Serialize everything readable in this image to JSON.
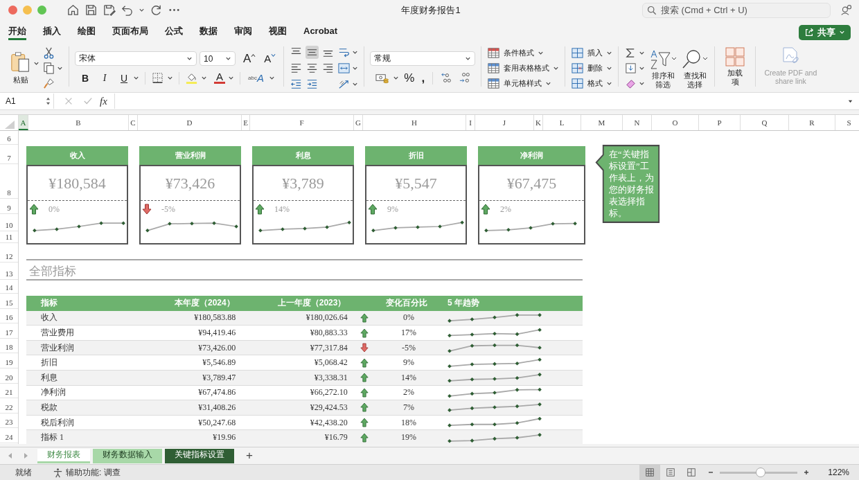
{
  "window": {
    "title": "年度财务报告1"
  },
  "search": {
    "placeholder": "搜索 (Cmd + Ctrl + U)"
  },
  "menu_tabs": [
    {
      "label": "开始",
      "selected": true
    },
    {
      "label": "插入",
      "selected": false
    },
    {
      "label": "绘图",
      "selected": false
    },
    {
      "label": "页面布局",
      "selected": false
    },
    {
      "label": "公式",
      "selected": false
    },
    {
      "label": "数据",
      "selected": false
    },
    {
      "label": "审阅",
      "selected": false
    },
    {
      "label": "视图",
      "selected": false
    },
    {
      "label": "Acrobat",
      "selected": false
    }
  ],
  "share_button": {
    "label": "共享"
  },
  "ribbon": {
    "paste": "粘贴",
    "font_name": "宋体",
    "font_size": "10",
    "grow_font": "A",
    "shrink_font": "A",
    "bold": "B",
    "italic": "I",
    "underline": "U",
    "font_color": "A",
    "abc_label": "abc",
    "abc_letter": "A",
    "number_format": "常规",
    "percent": "%",
    "comma": ",",
    "styles": [
      "条件格式",
      "套用表格格式",
      "单元格样式"
    ],
    "cells": [
      "插入",
      "删除",
      "格式"
    ],
    "sort": "排序和筛选",
    "find": "查找和选择",
    "addins": "加载项",
    "pdf": {
      "label": "Create PDF and share link",
      "disabled": true
    }
  },
  "formula_bar": {
    "name_box": "A1",
    "fx": "fx"
  },
  "columns": [
    "A",
    "B",
    "C",
    "D",
    "E",
    "F",
    "G",
    "H",
    "I",
    "J",
    "K",
    "L",
    "M",
    "N",
    "O",
    "P",
    "Q",
    "R",
    "S"
  ],
  "rows": [
    "6",
    "7",
    "8",
    "9",
    "10",
    "11",
    "12",
    "13",
    "14",
    "15",
    "16",
    "17",
    "18",
    "19",
    "20",
    "21",
    "22",
    "23",
    "24"
  ],
  "kpi_cards": [
    {
      "title": "收入",
      "value": "¥180,584",
      "rising": true,
      "change": "0%"
    },
    {
      "title": "营业利润",
      "value": "¥73,426",
      "rising": false,
      "change": "-5%"
    },
    {
      "title": "利息",
      "value": "¥3,789",
      "rising": true,
      "change": "14%"
    },
    {
      "title": "折旧",
      "value": "¥5,547",
      "rising": true,
      "change": "9%"
    },
    {
      "title": "净利润",
      "value": "¥67,475",
      "rising": true,
      "change": "2%"
    }
  ],
  "note": "在“关键指标设置”工作表上，为您的财务报表选择指标。",
  "section_title": "全部指标",
  "table": {
    "columns": [
      "指标",
      "本年度（2024）",
      "上一年度（2023）",
      "变化百分比",
      "5 年趋势"
    ],
    "rows": [
      {
        "name": "收入",
        "current": "¥180,583.88",
        "previous": "¥180,026.64",
        "rising": true,
        "change": "0%"
      },
      {
        "name": "营业费用",
        "current": "¥94,419.46",
        "previous": "¥80,883.33",
        "rising": true,
        "change": "17%"
      },
      {
        "name": "营业利润",
        "current": "¥73,426.00",
        "previous": "¥77,317.84",
        "rising": false,
        "change": "-5%"
      },
      {
        "name": "折旧",
        "current": "¥5,546.89",
        "previous": "¥5,068.42",
        "rising": true,
        "change": "9%"
      },
      {
        "name": "利息",
        "current": "¥3,789.47",
        "previous": "¥3,338.31",
        "rising": true,
        "change": "14%"
      },
      {
        "name": "净利润",
        "current": "¥67,474.86",
        "previous": "¥66,272.10",
        "rising": true,
        "change": "2%"
      },
      {
        "name": "税款",
        "current": "¥31,408.26",
        "previous": "¥29,424.53",
        "rising": true,
        "change": "7%"
      },
      {
        "name": "税后利润",
        "current": "¥50,247.68",
        "previous": "¥42,438.20",
        "rising": true,
        "change": "18%"
      },
      {
        "name": "指标 1",
        "current": "¥19.96",
        "previous": "¥16.79",
        "rising": true,
        "change": "19%"
      }
    ]
  },
  "sheet_tabs": [
    {
      "label": "财务报表",
      "selected": true,
      "color": "#a8d8a8"
    },
    {
      "label": "财务数据输入",
      "selected": false,
      "color": "#a8d8a8"
    },
    {
      "label": "关键指标设置",
      "selected": false,
      "color": "#2f5e34"
    }
  ],
  "add_sheet": "+",
  "status": {
    "ready": "就绪",
    "accessibility": "辅助功能: 调查",
    "zoom": "122%",
    "zoom_slider": {
      "level": 0.52
    }
  },
  "view_buttons": [
    {
      "selected": true
    },
    {
      "selected": false
    },
    {
      "selected": false
    }
  ]
}
